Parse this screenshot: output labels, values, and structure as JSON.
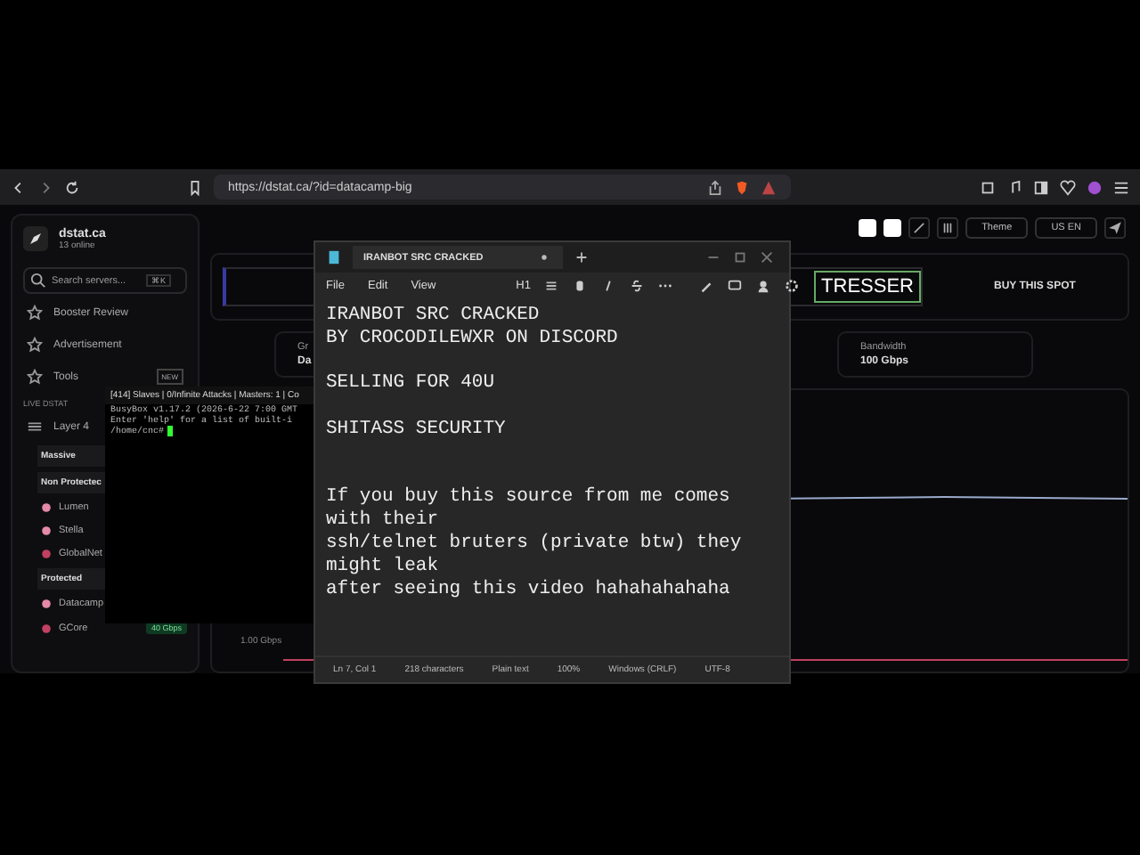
{
  "browser": {
    "url": "https://dstat.ca/?id=datacamp-big"
  },
  "sidebar": {
    "site": "dstat.ca",
    "online": "13 online",
    "search": {
      "placeholder": "Search servers...",
      "shortcut": "⌘K"
    },
    "nav": [
      {
        "label": "Booster Review"
      },
      {
        "label": "Advertisement"
      },
      {
        "label": "Tools",
        "badge": "NEW"
      }
    ],
    "section": "LIVE DSTAT",
    "group": "Layer 4",
    "items": [
      {
        "kind": "header",
        "label": "Massive"
      },
      {
        "kind": "header",
        "label": "Non Protectec"
      },
      {
        "kind": "server",
        "label": "Lumen",
        "color": "#e58aa8"
      },
      {
        "kind": "server",
        "label": "Stella",
        "color": "#e58aa8"
      },
      {
        "kind": "server",
        "label": "GlobalNet",
        "color": "#c24060"
      },
      {
        "kind": "header",
        "label": "Protected"
      },
      {
        "kind": "server",
        "label": "Datacamp",
        "color": "#e58aa8"
      },
      {
        "kind": "server",
        "label": "GCore",
        "color": "#c24060",
        "badge": "40 Gbps"
      }
    ]
  },
  "topbar": {
    "theme": "Theme",
    "language": "US EN"
  },
  "banner": {
    "logo_text": "TRESSER",
    "ad": "BUY THIS SPOT"
  },
  "stats": [
    {
      "label": "Gr",
      "value": "Da"
    },
    {
      "label": "Bandwidth",
      "value": "100 Gbps"
    }
  ],
  "graph": {
    "axis_label": "1.00 Gbps"
  },
  "terminal": {
    "title": "[414] Slaves | 0/Infinite Attacks | Masters: 1 | Co",
    "lines": [
      "BusyBox v1.17.2 (2026-6-22 7:00 GMT",
      "Enter 'help' for a list of built-i"
    ],
    "prompt": "/home/cnc#"
  },
  "notepad": {
    "tab": "IRANBOT SRC CRACKED",
    "menu": [
      "File",
      "Edit",
      "View"
    ],
    "heading": "H1",
    "lines": [
      {
        "kind": "text",
        "text": "IRANBOT SRC CRACKED"
      },
      {
        "kind": "text",
        "text": "BY CROCODILEWXR ON DISCORD"
      },
      {
        "kind": "blank"
      },
      {
        "kind": "text",
        "text": "SELLING FOR 40U"
      },
      {
        "kind": "blank"
      },
      {
        "kind": "text",
        "text": "SHITASS SECURITY"
      },
      {
        "kind": "blank"
      },
      {
        "kind": "blank"
      },
      {
        "kind": "text",
        "text": "If you buy this source from me comes with their"
      },
      {
        "kind": "text",
        "text": "ssh/telnet bruters (private btw) they might leak"
      },
      {
        "kind": "text",
        "text": "after seeing this video hahahahahaha"
      }
    ],
    "status": [
      "Ln 7, Col 1",
      "218 characters",
      "Plain text",
      "100%",
      "Windows (CRLF)",
      "UTF-8"
    ]
  }
}
